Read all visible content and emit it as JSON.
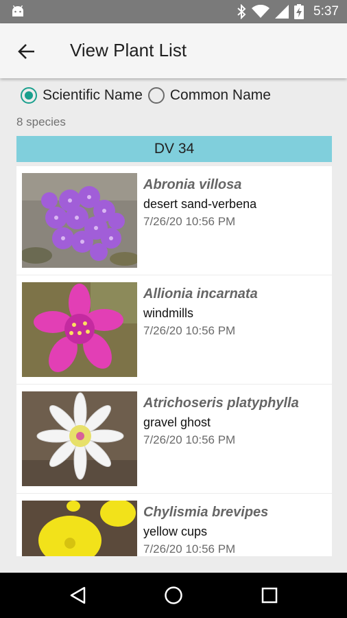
{
  "status_bar": {
    "time": "5:37",
    "icons": [
      "android-icon",
      "bluetooth-icon",
      "wifi-icon",
      "signal-icon",
      "battery-charging-icon"
    ]
  },
  "app_bar": {
    "title": "View Plant List",
    "back_icon": "arrow-back-icon"
  },
  "name_mode": {
    "options": [
      {
        "label": "Scientific Name",
        "selected": true
      },
      {
        "label": "Common Name",
        "selected": false
      }
    ]
  },
  "species_count": "8 species",
  "group_header": "DV 34",
  "plants": [
    {
      "scientific": "Abronia villosa",
      "common": "desert sand-verbena",
      "date": "7/26/20 10:56 PM",
      "image": "purple-flower-cluster"
    },
    {
      "scientific": "Allionia incarnata",
      "common": "windmills",
      "date": "7/26/20 10:56 PM",
      "image": "pink-flower"
    },
    {
      "scientific": "Atrichoseris platyphylla",
      "common": "gravel ghost",
      "date": "7/26/20 10:56 PM",
      "image": "white-daisy-flower"
    },
    {
      "scientific": "Chylismia brevipes",
      "common": "yellow cups",
      "date": "7/26/20 10:56 PM",
      "image": "yellow-cup-flower"
    }
  ],
  "colors": {
    "accent": "#199f8d",
    "group_header_bg": "#80cfdc",
    "status_bar_bg": "#7a7a7a",
    "nav_bar_bg": "#000000"
  },
  "nav_bar": [
    "back-triangle-icon",
    "home-circle-icon",
    "recents-square-icon"
  ]
}
